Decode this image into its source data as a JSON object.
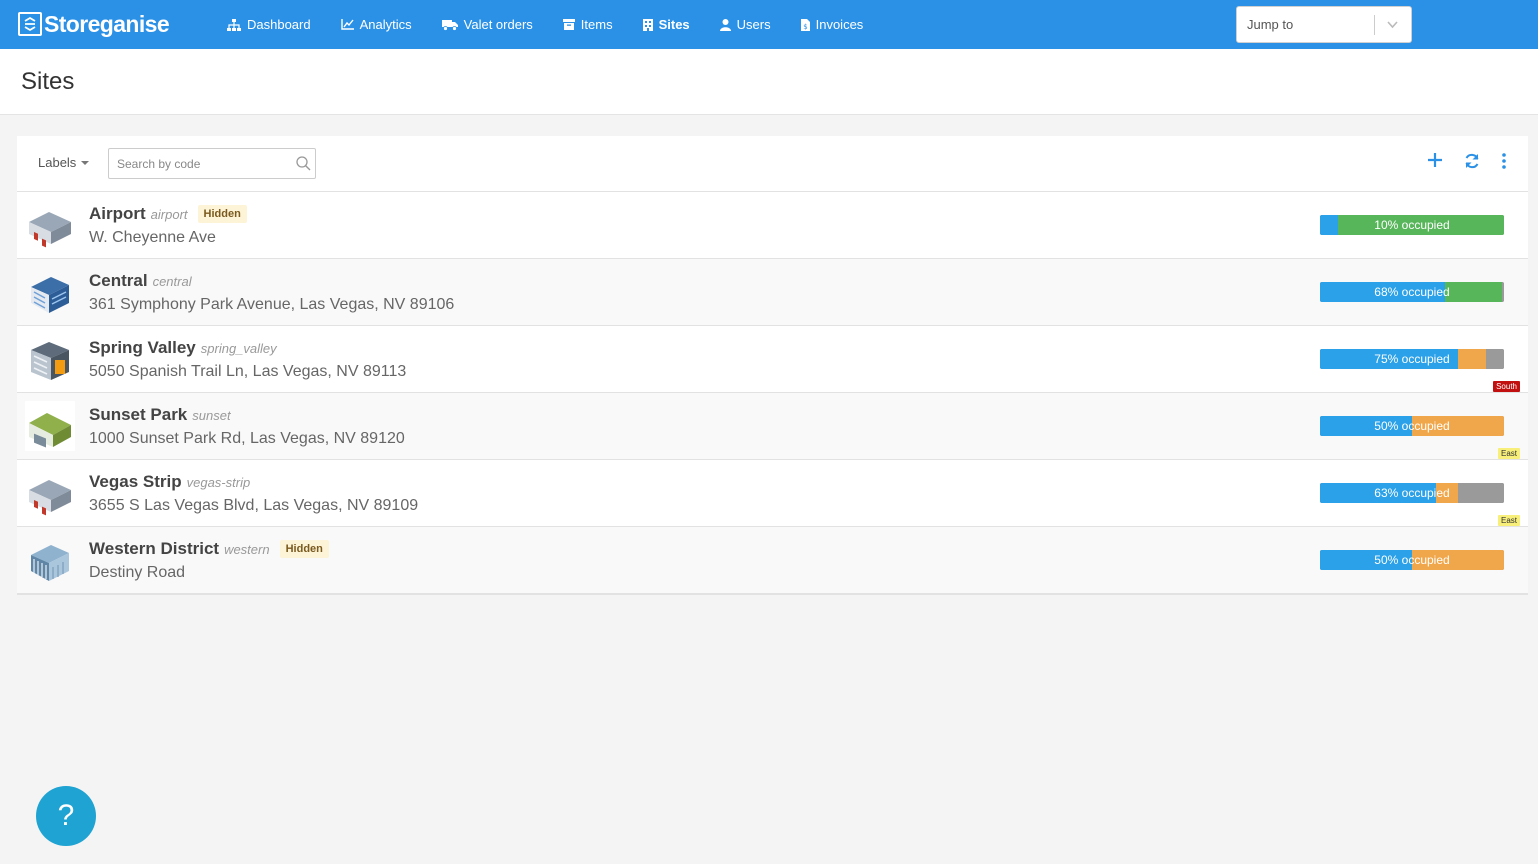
{
  "app": {
    "logo_text": "Storeganise"
  },
  "nav": {
    "items": [
      {
        "label": "Dashboard",
        "icon": "sitemap-icon"
      },
      {
        "label": "Analytics",
        "icon": "line-chart-icon"
      },
      {
        "label": "Valet orders",
        "icon": "truck-icon"
      },
      {
        "label": "Items",
        "icon": "archive-icon"
      },
      {
        "label": "Sites",
        "icon": "building-icon",
        "active": true
      },
      {
        "label": "Users",
        "icon": "user-icon"
      },
      {
        "label": "Invoices",
        "icon": "invoice-icon"
      }
    ],
    "jump_placeholder": "Jump to"
  },
  "page": {
    "title": "Sites"
  },
  "toolbar": {
    "labels_button": "Labels",
    "search_placeholder": "Search by code",
    "icons": [
      "plus-icon",
      "refresh-icon",
      "more-vertical-icon"
    ]
  },
  "sites": [
    {
      "name": "Airport",
      "code": "airport",
      "hidden_badge": "Hidden",
      "address": "W. Cheyenne Ave",
      "occupancy_label": "10% occupied",
      "occupied_pct": 10,
      "bar": {
        "green": 90,
        "orange": 0,
        "grey": 0
      },
      "region": ""
    },
    {
      "name": "Central",
      "code": "central",
      "hidden_badge": "",
      "address": "361 Symphony Park Avenue, Las Vegas, NV 89106",
      "occupancy_label": "68% occupied",
      "occupied_pct": 68,
      "bar": {
        "green": 31,
        "orange": 0,
        "grey": 1
      },
      "region": ""
    },
    {
      "name": "Spring Valley",
      "code": "spring_valley",
      "hidden_badge": "",
      "address": "5050 Spanish Trail Ln, Las Vegas, NV 89113",
      "occupancy_label": "75% occupied",
      "occupied_pct": 75,
      "bar": {
        "green": 0,
        "orange": 15,
        "grey": 10
      },
      "region": "South"
    },
    {
      "name": "Sunset Park",
      "code": "sunset",
      "hidden_badge": "",
      "address": "1000 Sunset Park Rd, Las Vegas, NV 89120",
      "occupancy_label": "50% occupied",
      "occupied_pct": 50,
      "bar": {
        "green": 0,
        "orange": 50,
        "grey": 0
      },
      "region": "East"
    },
    {
      "name": "Vegas Strip",
      "code": "vegas-strip",
      "hidden_badge": "",
      "address": "3655 S Las Vegas Blvd, Las Vegas, NV 89109",
      "occupancy_label": "63% occupied",
      "occupied_pct": 63,
      "bar": {
        "green": 0,
        "orange": 12,
        "grey": 25
      },
      "region": "East"
    },
    {
      "name": "Western District",
      "code": "western",
      "hidden_badge": "Hidden",
      "address": "Destiny Road",
      "occupancy_label": "50% occupied",
      "occupied_pct": 50,
      "bar": {
        "green": 0,
        "orange": 50,
        "grey": 0
      },
      "region": ""
    }
  ],
  "help_button": "?",
  "colors": {
    "brand": "#2b91e6",
    "occupied": "#2aa1e8",
    "available": "#58b65a",
    "reserved": "#f0a64a",
    "other": "#9a9a9a",
    "help": "#1ea3d2"
  }
}
